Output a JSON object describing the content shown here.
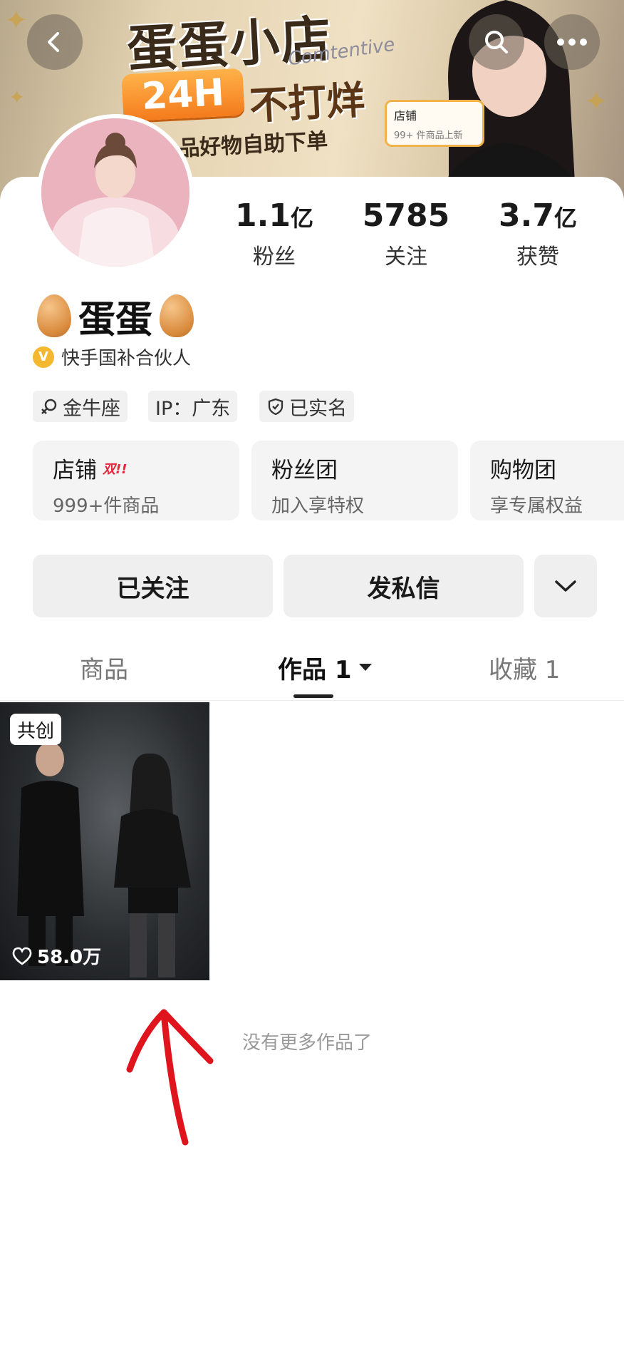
{
  "banner": {
    "title": "蛋蛋小店",
    "badge_24h": "24H",
    "no_closing": "不打烊",
    "subtitle": "品好物自助下单",
    "script_text": "Comtentive",
    "bubble_title": "店铺",
    "bubble_sub": "99+ 件商品上新"
  },
  "stats": [
    {
      "value": "1.1",
      "unit": "亿",
      "label": "粉丝"
    },
    {
      "value": "5785",
      "unit": "",
      "label": "关注"
    },
    {
      "value": "3.7",
      "unit": "亿",
      "label": "获赞"
    }
  ],
  "profile": {
    "name": "蛋蛋",
    "badge_letter": "V",
    "partner": "快手国补合伙人"
  },
  "chips": [
    "金牛座",
    "IP：广东",
    "已实名"
  ],
  "feature_cards": [
    {
      "title": "店铺",
      "tag": "双!!",
      "subtitle": "999+件商品"
    },
    {
      "title": "粉丝团",
      "subtitle": "加入享特权"
    },
    {
      "title": "购物团",
      "subtitle": "享专属权益"
    }
  ],
  "actions": {
    "followed": "已关注",
    "message": "发私信"
  },
  "tabs": {
    "goods": "商品",
    "works": "作品 1",
    "favorites": "收藏 1"
  },
  "video": {
    "badge": "共创",
    "likes": "58.0万"
  },
  "empty_text": "没有更多作品了",
  "colors": {
    "accent_orange": "#f47b1c",
    "badge_gold": "#f3b730",
    "annotation_red": "#e0141c"
  }
}
